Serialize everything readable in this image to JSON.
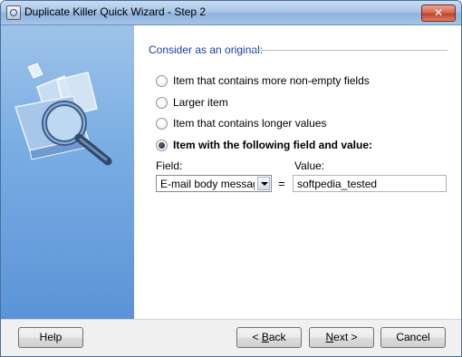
{
  "window": {
    "title": "Duplicate Killer Quick Wizard - Step 2",
    "close_label": "✕"
  },
  "section": {
    "heading": "Consider as an original:"
  },
  "options": [
    {
      "label": "Item that contains more non-empty fields",
      "checked": false
    },
    {
      "label": "Larger item",
      "checked": false
    },
    {
      "label": "Item that contains longer values",
      "checked": false
    },
    {
      "label": "Item with the following field and value:",
      "checked": true
    }
  ],
  "field": {
    "caption": "Field:",
    "selected": "E-mail body message (",
    "equals": "="
  },
  "value": {
    "caption": "Value:",
    "text": "softpedia_tested"
  },
  "buttons": {
    "help": "Help",
    "back_arrow": "< ",
    "back_mnemonic": "B",
    "back_rest": "ack",
    "next_mnemonic": "N",
    "next_rest": "ext >",
    "cancel": "Cancel"
  },
  "colors": {
    "heading": "#1a3fa3",
    "side_panel": "#7aaee3"
  }
}
